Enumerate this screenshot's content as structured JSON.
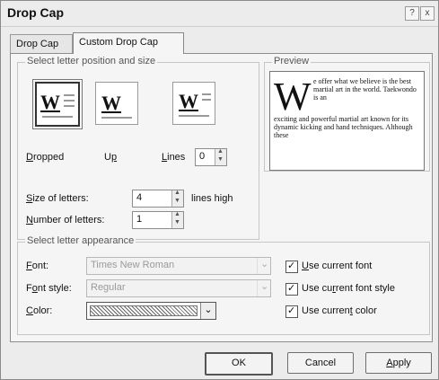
{
  "title": "Drop Cap",
  "title_buttons": {
    "help": "?",
    "close": "x"
  },
  "tabs": [
    "Drop Cap",
    "Custom Drop Cap"
  ],
  "position_group": {
    "legend": "Select letter position and size",
    "options": [
      {
        "label_pre": "",
        "label_u": "D",
        "label_post": "ropped",
        "icon": "W"
      },
      {
        "label_pre": "U",
        "label_u": "p",
        "label_post": "",
        "icon": "W"
      },
      {
        "label_pre": "",
        "label_u": "L",
        "label_post": "ines",
        "icon": "W"
      }
    ],
    "lines_value": "0",
    "size_label": {
      "pre": "",
      "u": "S",
      "post": "ize of letters:"
    },
    "size_value": "4",
    "size_unit": "lines high",
    "number_label": {
      "pre": "",
      "u": "N",
      "post": "umber of letters:"
    },
    "number_value": "1"
  },
  "preview": {
    "legend": "Preview",
    "dropcap": "W",
    "text_side": "e offer what we believe is the best martial art in the world. Taekwondo is an",
    "text_below": "exciting and powerful martial art known for its dynamic kicking and hand techniques. Although these"
  },
  "appearance": {
    "legend": "Select letter appearance",
    "font_label": {
      "pre": "",
      "u": "F",
      "post": "ont:"
    },
    "font_value": "Times New Roman",
    "style_label": {
      "pre": "F",
      "u": "o",
      "post": "nt style:"
    },
    "style_value": "Regular",
    "color_label": {
      "pre": "",
      "u": "C",
      "post": "olor:"
    },
    "check_font": {
      "pre": "",
      "u": "U",
      "post": "se current font"
    },
    "check_style": {
      "pre": "Use cu",
      "u": "r",
      "post": "rent font style"
    },
    "check_color": {
      "pre": "Use curren",
      "u": "t",
      "post": " color"
    }
  },
  "buttons": {
    "ok": "OK",
    "cancel": "Cancel",
    "apply_u": "A",
    "apply_post": "pply"
  }
}
